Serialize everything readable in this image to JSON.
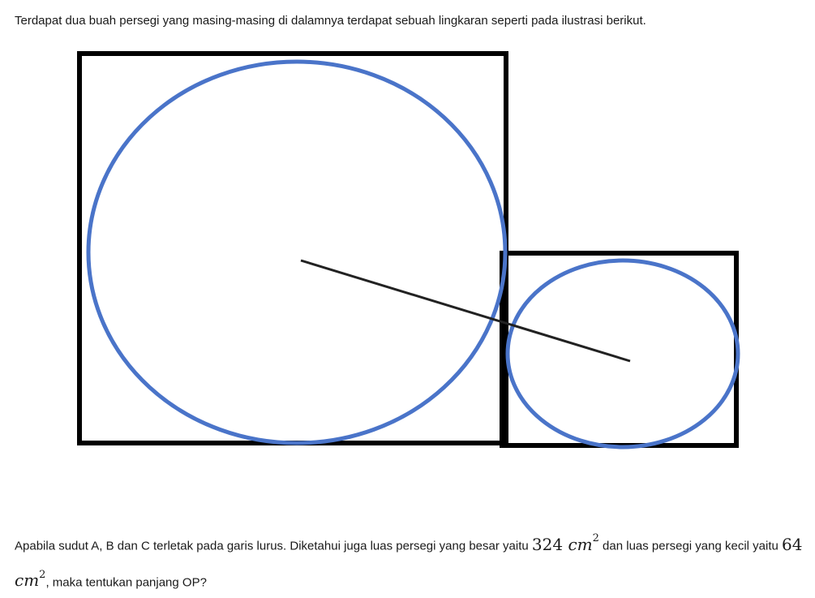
{
  "intro_text": "Terdapat dua buah persegi yang masing-masing di dalamnya terdapat sebuah lingkaran seperti pada ilustrasi berikut.",
  "question": {
    "part1": "Apabila sudut A, B dan C terletak pada garis lurus. Diketahui juga luas persegi yang besar yaitu ",
    "big_area_value": "324",
    "part2": " dan luas persegi yang kecil yaitu ",
    "small_area_value": "64",
    "part3": ", maka tentukan panjang OP?",
    "unit": "cm",
    "exponent": "2"
  },
  "colors": {
    "square_stroke": "#000000",
    "circle_stroke": "#4a74c9",
    "line_stroke": "#222222"
  }
}
